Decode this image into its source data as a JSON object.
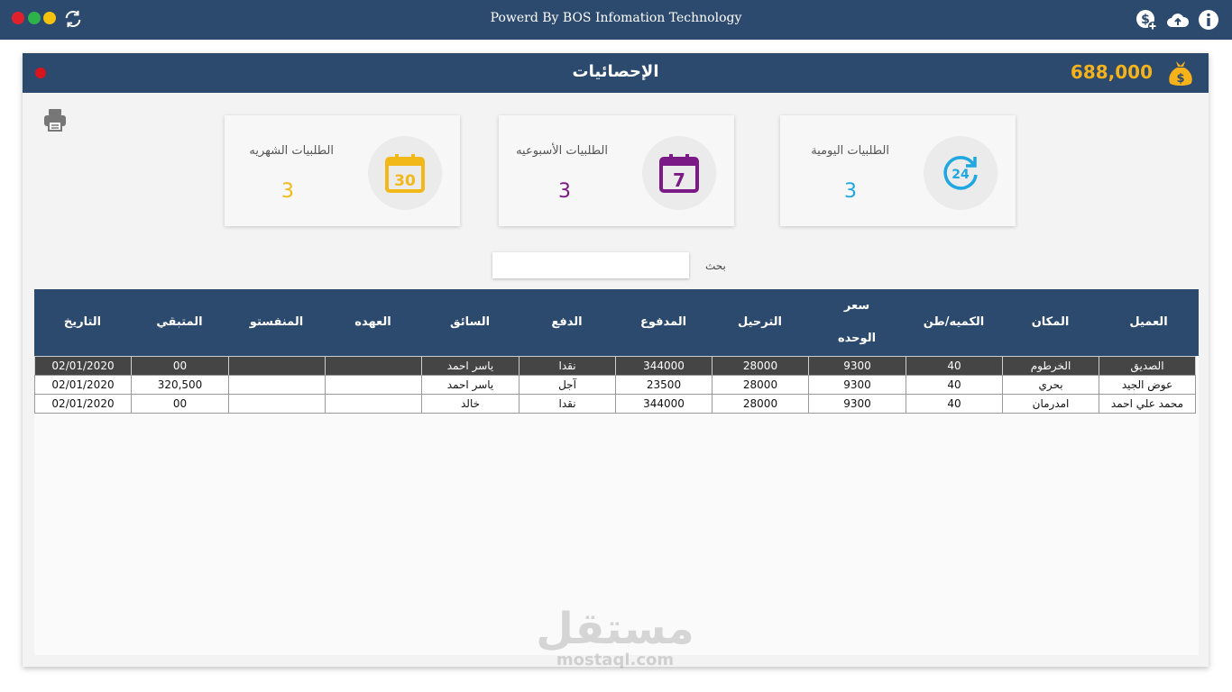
{
  "titlebar": {
    "title": "Powerd By BOS Infomation Technology",
    "icons": [
      "close-dot",
      "maximize-dot",
      "minimize-dot",
      "refresh-icon",
      "add-money-icon",
      "cloud-upload-icon",
      "info-icon"
    ]
  },
  "panel": {
    "title": "الإحصائيات",
    "balance": "688,000",
    "balance_icon": "money-bag-icon",
    "accent": "#f5b21a"
  },
  "cards": [
    {
      "label": "الطلبيات اليومية",
      "value": "3",
      "icon": "24-hours-icon",
      "color": "#1ea7e1"
    },
    {
      "label": "الطلبيات الأسبوعيه",
      "value": "3",
      "icon": "calendar-7-icon",
      "color": "#7b1a86"
    },
    {
      "label": "الطلبيات الشهريه",
      "value": "3",
      "icon": "calendar-30-icon",
      "color": "#f2b718"
    }
  ],
  "search": {
    "label": "بحث",
    "value": ""
  },
  "table": {
    "headers": {
      "client": "العميل",
      "place": "المكان",
      "qty": "الكميه/طن",
      "unit_price_1": "سعر",
      "unit_price_2": "الوحده",
      "transport": "الترحيل",
      "paid": "المدفوع",
      "payment": "الدفع",
      "driver": "السائق",
      "custody": "العهده",
      "manifest": "المنفستو",
      "remaining": "المتبقي",
      "date": "التاريخ"
    },
    "rows": [
      {
        "client": "الصديق",
        "place": "الخرطوم",
        "qty": "40",
        "unit_price": "9300",
        "transport": "28000",
        "paid": "344000",
        "payment": "نقدا",
        "driver": "ياسر احمد",
        "custody": "",
        "manifest": "",
        "remaining": "00",
        "date": "02/01/2020"
      },
      {
        "client": "عوض الجيد",
        "place": "بحري",
        "qty": "40",
        "unit_price": "9300",
        "transport": "28000",
        "paid": "23500",
        "payment": "آجل",
        "driver": "ياسر احمد",
        "custody": "",
        "manifest": "",
        "remaining": "320,500",
        "date": "02/01/2020"
      },
      {
        "client": "محمد علي احمد",
        "place": "امدرمان",
        "qty": "40",
        "unit_price": "9300",
        "transport": "28000",
        "paid": "344000",
        "payment": "نقدا",
        "driver": "خالد",
        "custody": "",
        "manifest": "",
        "remaining": "00",
        "date": "02/01/2020"
      }
    ]
  },
  "watermark": {
    "arabic": "مستقل",
    "latin": "mostaql.com"
  }
}
